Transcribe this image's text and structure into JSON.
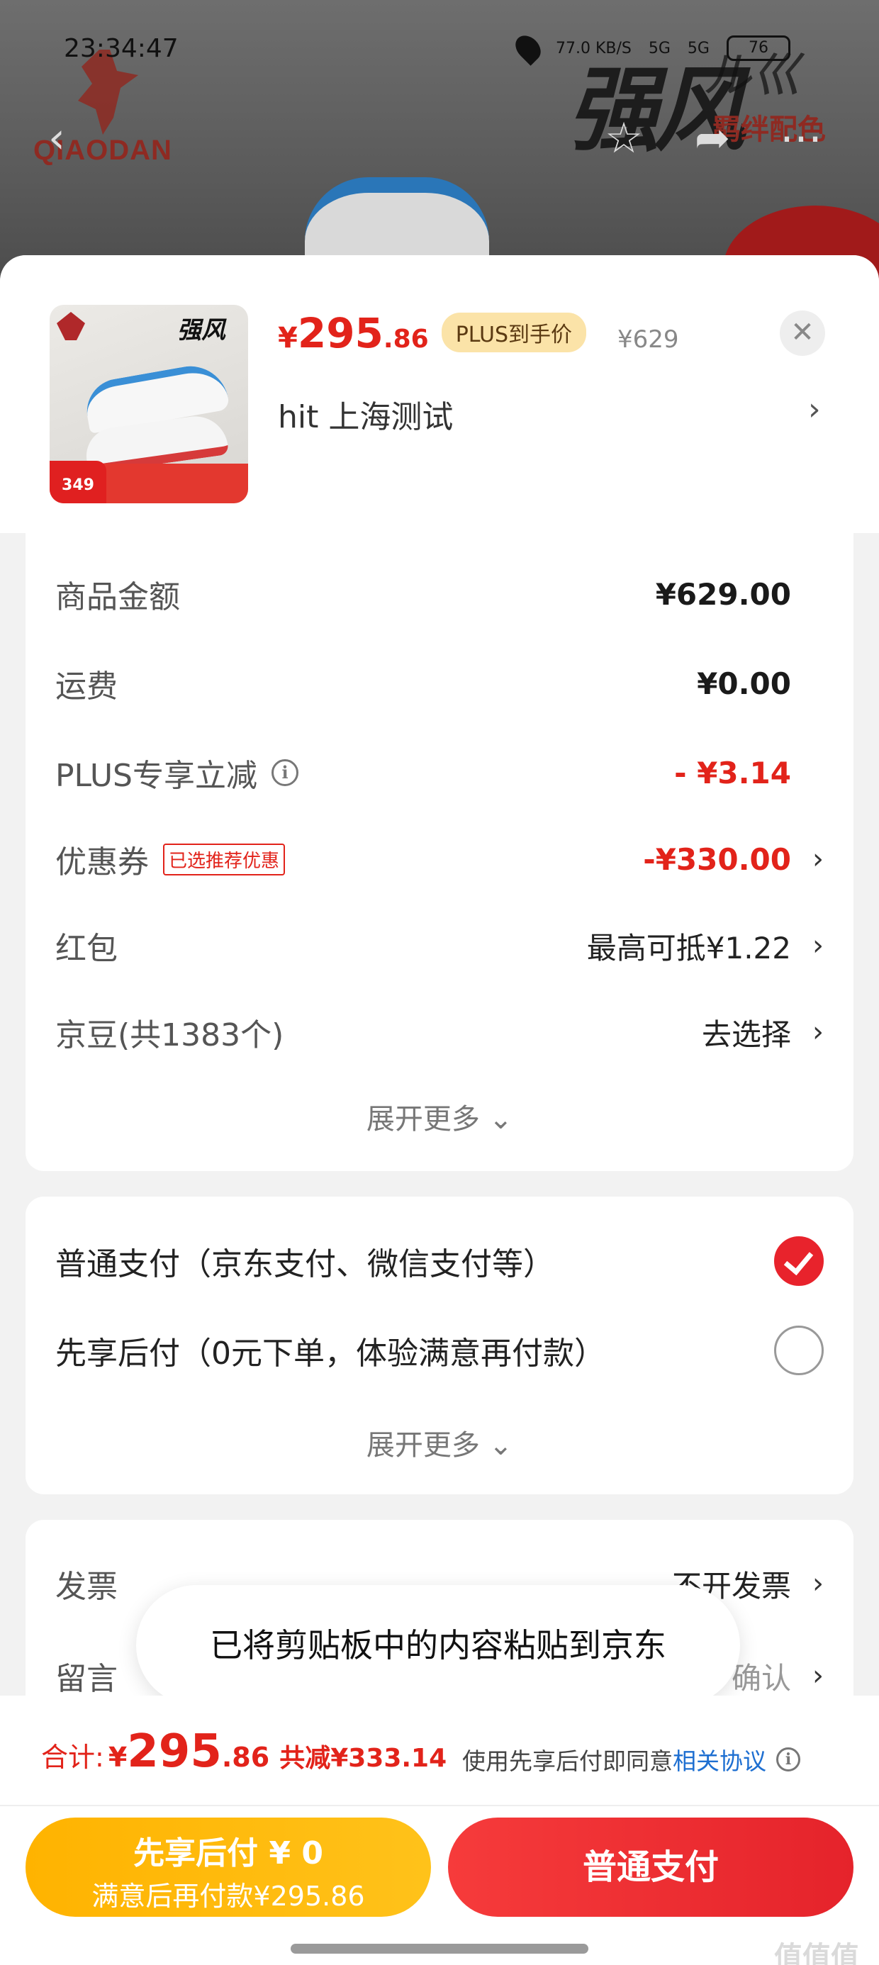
{
  "status_bar": {
    "time": "23:34:47",
    "net_speed": "77.0 KB/S",
    "signal1": "5G",
    "signal2": "5G",
    "battery": "76"
  },
  "background": {
    "brand_logo_text": "QIAODAN",
    "product_title": "强风",
    "product_title_latin": "ル巛",
    "colorway": "羁绊配色"
  },
  "product": {
    "currency": "¥",
    "price_int": "295",
    "price_dec": ".86",
    "plus_tag": "PLUS到手价",
    "original_price": "¥629",
    "address": "hit  上海测试",
    "thumb_badge": "349"
  },
  "cost_rows": [
    {
      "label": "商品金额",
      "value": "¥629.00"
    },
    {
      "label": "运费",
      "value": "¥0.00"
    },
    {
      "label": "PLUS专享立减",
      "value": "- ¥3.14"
    },
    {
      "label": "优惠券",
      "tag": "已选推荐优惠",
      "value": "-¥330.00"
    },
    {
      "label": "红包",
      "value": "最高可抵¥1.22"
    },
    {
      "label": "京豆(共1383个)",
      "value": "去选择"
    }
  ],
  "expand_more": "展开更多",
  "payment_options": [
    {
      "label": "普通支付（京东支付、微信支付等）",
      "selected": true
    },
    {
      "label": "先享后付（0元下单，体验满意再付款）",
      "selected": false
    }
  ],
  "extra_rows": [
    {
      "label": "发票",
      "value": "不开发票"
    },
    {
      "label": "留言",
      "value": "确认"
    }
  ],
  "toast": "已将剪贴板中的内容粘贴到京东",
  "footer": {
    "total_label": "合计:",
    "total_currency": "¥",
    "total_int": "295",
    "total_dec": ".86",
    "saved": "共减¥333.14",
    "agree_text": "使用先享后付即同意",
    "agree_link": "相关协议",
    "btn_later_line1": "先享后付 ¥ 0",
    "btn_later_line2": "满意后再付款¥295.86",
    "btn_pay": "普通支付",
    "watermark": "值值值"
  },
  "colors": {
    "accent_red": "#e2231a",
    "plus_gold": "#fbe3a8",
    "pay_later_yellow": "#ffb300",
    "link_blue": "#1e6fd1"
  }
}
